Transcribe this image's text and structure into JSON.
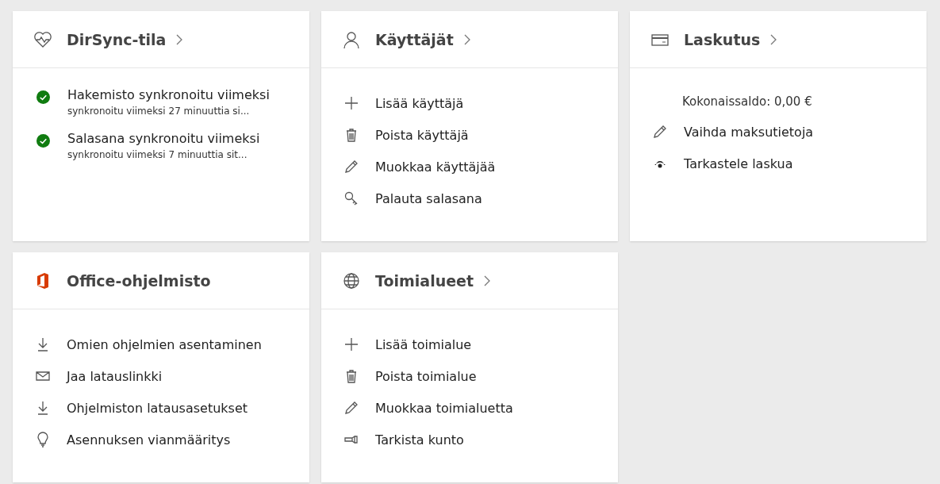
{
  "cards": [
    {
      "kind": "dirsync",
      "title": "DirSync-tila",
      "link": true,
      "items": [
        {
          "kind": "status",
          "label": "Hakemisto synkronoitu viimeksi",
          "detail": "synkronoitu viimeksi 27 minuuttia si..."
        },
        {
          "kind": "status",
          "label": "Salasana synkronoitu viimeksi",
          "detail": "synkronoitu viimeksi 7 minuuttia sit..."
        }
      ]
    },
    {
      "kind": "users",
      "title": "Käyttäjät",
      "link": true,
      "items": [
        {
          "kind": "add",
          "label": "Lisää käyttäjä"
        },
        {
          "kind": "delete",
          "label": "Poista käyttäjä"
        },
        {
          "kind": "edit",
          "label": "Muokkaa käyttäjää"
        },
        {
          "kind": "reset",
          "label": "Palauta salasana"
        }
      ]
    },
    {
      "kind": "billing",
      "title": "Laskutus",
      "link": true,
      "items": [
        {
          "kind": "balance",
          "label": "Kokonaissaldo: 0,00 €"
        },
        {
          "kind": "edit",
          "label": "Vaihda maksutietoja"
        },
        {
          "kind": "view",
          "label": "Tarkastele laskua"
        }
      ]
    },
    {
      "kind": "office",
      "title": "Office-ohjelmisto",
      "link": false,
      "items": [
        {
          "kind": "install",
          "label": "Omien ohjelmien asentaminen"
        },
        {
          "kind": "share",
          "label": "Jaa latauslinkki"
        },
        {
          "kind": "install",
          "label": "Ohjelmiston latausasetukset"
        },
        {
          "kind": "troubleshoot",
          "label": "Asennuksen vianmääritys"
        }
      ]
    },
    {
      "kind": "domains",
      "title": "Toimialueet",
      "link": true,
      "items": [
        {
          "kind": "add",
          "label": "Lisää toimialue"
        },
        {
          "kind": "delete",
          "label": "Poista toimialue"
        },
        {
          "kind": "edit",
          "label": "Muokkaa toimialuetta"
        },
        {
          "kind": "health",
          "label": "Tarkista kunto"
        }
      ]
    }
  ]
}
